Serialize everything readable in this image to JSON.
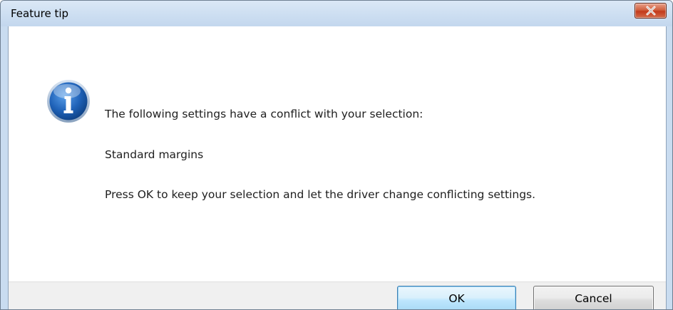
{
  "window": {
    "title": "Feature tip",
    "close_icon": "close-icon"
  },
  "message": {
    "icon": "info-icon",
    "line1": "The following settings have a conflict with your selection:",
    "line2": "Standard margins",
    "line3": "Press OK to keep your selection and let the driver change conflicting settings."
  },
  "buttons": {
    "ok_label": "OK",
    "cancel_label": "Cancel"
  },
  "colors": {
    "title_bar": "#cfe0f2",
    "close_button": "#c2391b",
    "info_icon": "#1f62b8",
    "footer": "#f0f0f0"
  }
}
